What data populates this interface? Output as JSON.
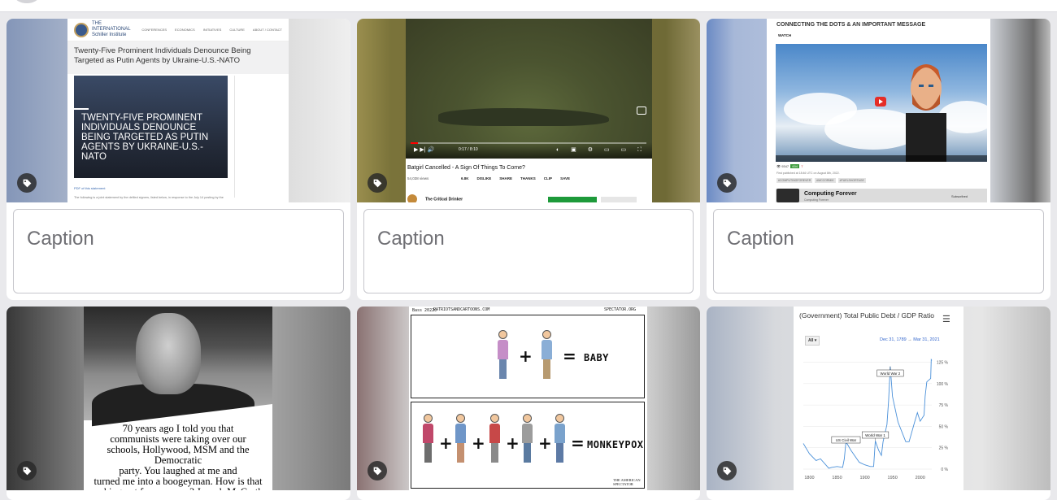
{
  "cards": [
    {
      "caption_placeholder": "Caption",
      "schiller": {
        "institute_name": "THE INTERNATIONAL Schiller Institute",
        "nav": [
          "CONFERENCES",
          "ECONOMICS",
          "INITIATIVES",
          "CULTURE",
          "ABOUT / CONTACT"
        ],
        "headline": "Twenty-Five Prominent Individuals Denounce Being Targeted as Putin Agents by Ukraine-U.S.-NATO",
        "photo_text": "TWENTY-FIVE PROMINENT INDIVIDUALS DENOUNCE BEING TARGETED AS PUTIN AGENTS BY UKRAINE-U.S.-NATO",
        "pdf_link": "PDF of this statement",
        "body_text": "The following is a joint statement by the defiled signers, listed below, in response to the July 14 posting by the"
      }
    },
    {
      "caption_placeholder": "Caption",
      "youtube": {
        "time": "0:17 / 8:10",
        "title": "Batgirl Cancelled - A Sign Of Things To Come?",
        "views": "54,038 views",
        "likes": "6.8K",
        "actions": [
          "DISLIKE",
          "SHARE",
          "THANKS",
          "CLIP",
          "SAVE"
        ],
        "channel": "The Critical Drinker"
      }
    },
    {
      "caption_placeholder": "Caption",
      "computing": {
        "title": "CONNECTING THE DOTS & AN IMPORTANT MESSAGE",
        "watch": "WATCH",
        "views": "9347",
        "upvotes": "604",
        "downvotes": "7",
        "published": "First published at 18:46 UTC on August 8th, 2022.",
        "tags": [
          "#COMPUTINGFOREVER",
          "#MCCORMIK",
          "#FUELSHORTAGE"
        ],
        "channel": "Computing Forever",
        "channel_sub": "Computing Forever",
        "subscribed": "Subscribed"
      }
    },
    {
      "mccarthy": {
        "quote_lines": [
          "70 years ago I told you that",
          "communists were taking over our",
          "schools, Hollywood, MSM and the Democratic",
          "party. You laughed at me and",
          "turned me into a boogeyman. How is that",
          "working out for you now?  Joseph McCarthy"
        ]
      }
    },
    {
      "cartoon": {
        "artist": "Bass 2022©",
        "site_left": "PATRIOTSANDCARTOONS.COM",
        "site_right": "SPECTATOR.ORG",
        "top_result": "BABY",
        "bottom_result": "MONKEYPOX",
        "credit": "THE AMERICAN SPECTATOR"
      }
    },
    {
      "chart_data": {
        "type": "line",
        "title": "(Government) Total Public Debt / GDP Ratio",
        "range_button": "All",
        "date_from": "Dec 31, 1789",
        "date_arrow": "→",
        "date_to": "Mar 31, 2021",
        "x_ticks": [
          "1800",
          "1850",
          "1900",
          "1950",
          "2000"
        ],
        "y_ticks": [
          "0 %",
          "25 %",
          "50 %",
          "75 %",
          "100 %",
          "125 %"
        ],
        "xlim": [
          1789,
          2021
        ],
        "ylim": [
          0,
          135
        ],
        "series": [
          {
            "x": [
              1789,
              1800,
              1812,
              1820,
              1835,
              1840,
              1850,
              1860,
              1863,
              1866,
              1875,
              1890,
              1900,
              1910,
              1916,
              1919,
              1925,
              1930,
              1933,
              1940,
              1943,
              1946,
              1950,
              1960,
              1974,
              1980,
              1990,
              1995,
              2000,
              2007,
              2009,
              2012,
              2019,
              2020,
              2021
            ],
            "y": [
              30,
              18,
              10,
              12,
              1,
              2,
              3,
              2,
              12,
              32,
              22,
              8,
              5,
              3,
              3,
              33,
              22,
              16,
              32,
              52,
              80,
              120,
              85,
              55,
              32,
              32,
              55,
              66,
              56,
              63,
              85,
              102,
              106,
              128,
              127
            ]
          }
        ],
        "annotations": [
          {
            "label": "US Civil War",
            "x": 1866
          },
          {
            "label": "World War 1",
            "x": 1919
          },
          {
            "label": "World War 2",
            "x": 1946
          }
        ]
      }
    }
  ],
  "icons": {
    "tag": "tag-icon"
  }
}
